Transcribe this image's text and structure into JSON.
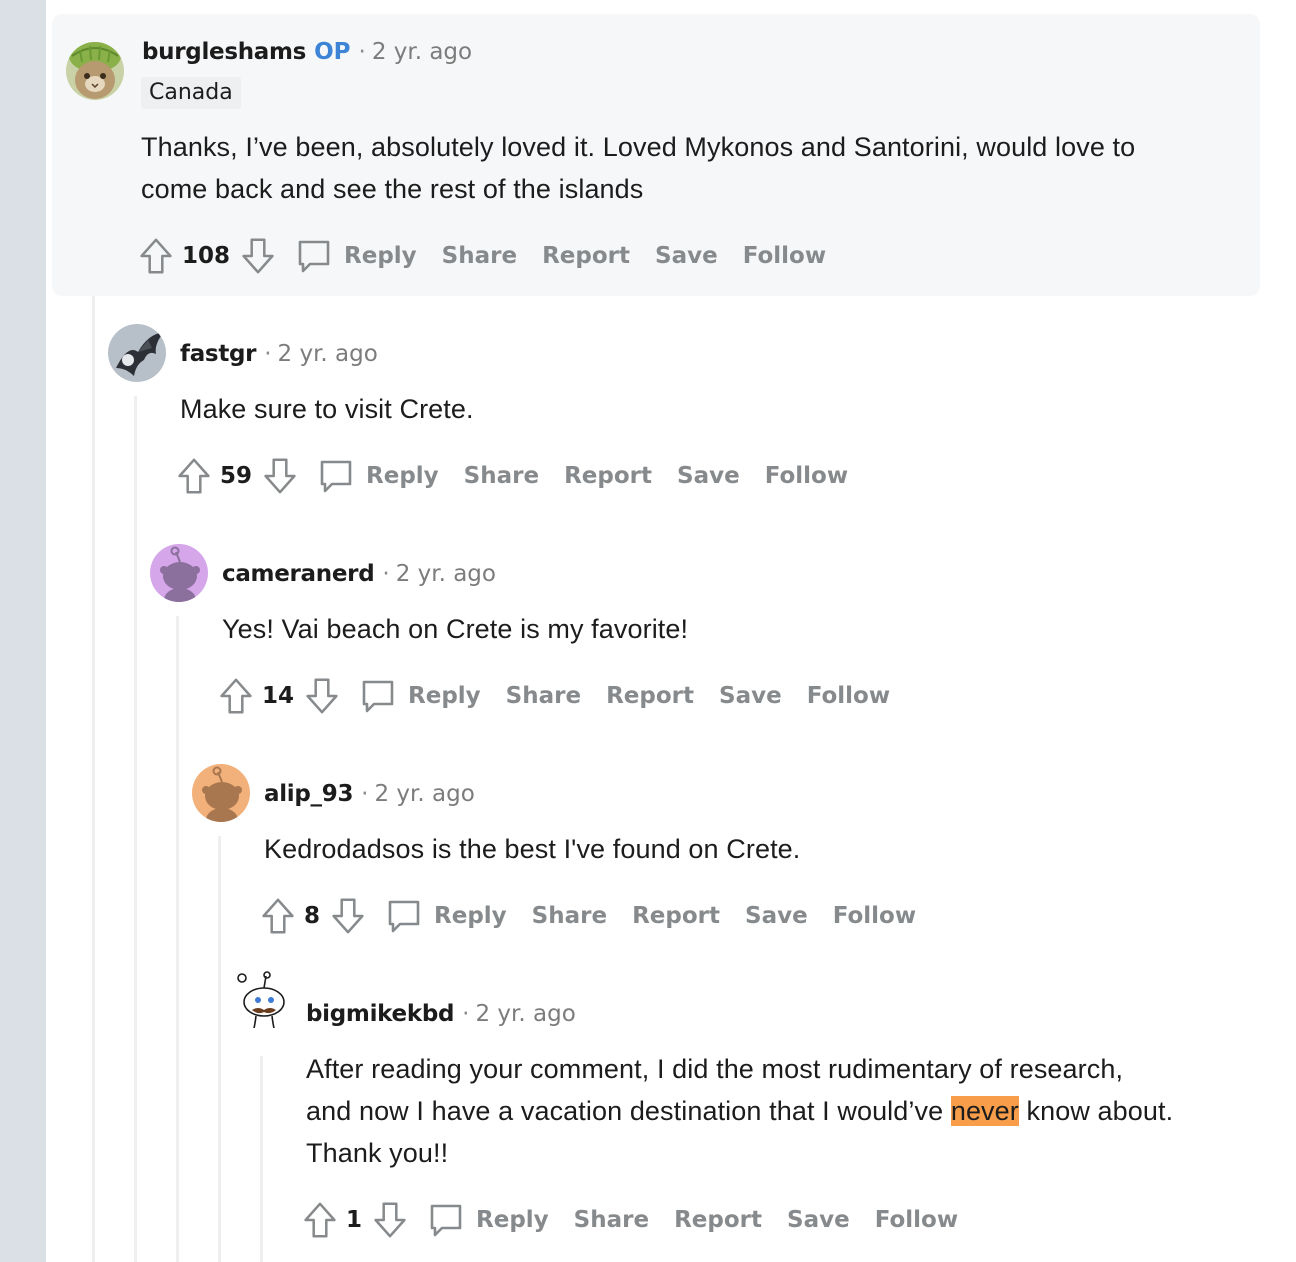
{
  "comments": [
    {
      "username": "burgleshams",
      "op_label": "OP",
      "age": "2 yr. ago",
      "flair": "Canada",
      "body": [
        "Thanks, I’ve been, absolutely loved it. Loved Mykonos and Santorini, would love to",
        "come back and see the rest of the islands"
      ],
      "score": "108",
      "avatar": "melon-cat-avatar"
    },
    {
      "username": "fastgr",
      "age": "2 yr. ago",
      "body": [
        "Make sure to visit Crete."
      ],
      "score": "59",
      "avatar": "dragon-avatar"
    },
    {
      "username": "cameranerd",
      "age": "2 yr. ago",
      "body": [
        "Yes! Vai beach on Crete is my favorite!"
      ],
      "score": "14",
      "avatar": "snoo-purple-avatar"
    },
    {
      "username": "alip_93",
      "age": "2 yr. ago",
      "body": [
        "Kedrodadsos is the best I've found on Crete."
      ],
      "score": "8",
      "avatar": "snoo-orange-avatar"
    },
    {
      "username": "bigmikekbd",
      "age": "2 yr. ago",
      "body_line1": "After reading your comment, I did the most rudimentary of research,",
      "body_line2_pre": "and now I have a vacation destination that I would’ve",
      "body_line2_hl": "never",
      "body_line2_post": "know about.",
      "body_line3": "Thank you!!",
      "score": "1",
      "avatar": "snoo-mustache-avatar"
    }
  ],
  "actions": {
    "reply": "Reply",
    "share": "Share",
    "report": "Report",
    "save": "Save",
    "follow": "Follow"
  },
  "separator": "·",
  "colors": {
    "op": "#3d84d6",
    "highlight": "#f89e4b",
    "meta_gray": "#878a8c",
    "card_bg": "#f6f7f8",
    "rail": "#dae0e6"
  }
}
